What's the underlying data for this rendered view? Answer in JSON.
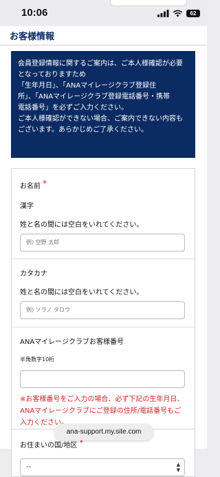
{
  "status_bar": {
    "time": "10:06",
    "battery": "62",
    "icons": [
      "signal-icon",
      "wifi-icon",
      "battery-icon"
    ]
  },
  "section": {
    "title": "お客様情報"
  },
  "notice": {
    "lines": [
      "会員登録情報に関するご案内は、ご本人様確認が必要",
      "となっておりますため",
      "「生年月日」、「ANAマイレージクラブ登録住",
      "所」、「ANAマイレージクラブ登録電話番号・携帯",
      "電話番号」を必ずご入力ください。",
      "ご本人様確認ができない場合、ご案内できない内容も",
      "ございます。あらかじめご了承ください。"
    ]
  },
  "form": {
    "name_label": "お名前",
    "required_mark": "*",
    "kanji_label": "漢字",
    "kanji_hint": "姓と名の間には空白をいれてください。",
    "kanji_placeholder": "例) 空野 太郎",
    "katakana_label": "カタカナ",
    "katakana_hint": "姓と名の間には空白をいれてください。",
    "katakana_placeholder": "例) ソラノ タロウ",
    "ana_number_label": "ANAマイレージクラブお客様番号",
    "ana_number_hint": "半角数字10桁",
    "ana_number_value": "",
    "warning_lines": [
      "※お客様番号をご入力の場合、必ず下記の生年月日、",
      "ANAマイレージクラブにご登録の住所/電話番号もご",
      "入力ください。"
    ],
    "country_label": "お住まいの国/地区",
    "country_value": "--"
  },
  "browser": {
    "url": "ana-support.my.site.com"
  },
  "colors": {
    "navy": "#0b2b63",
    "required_red": "#d2232a"
  }
}
